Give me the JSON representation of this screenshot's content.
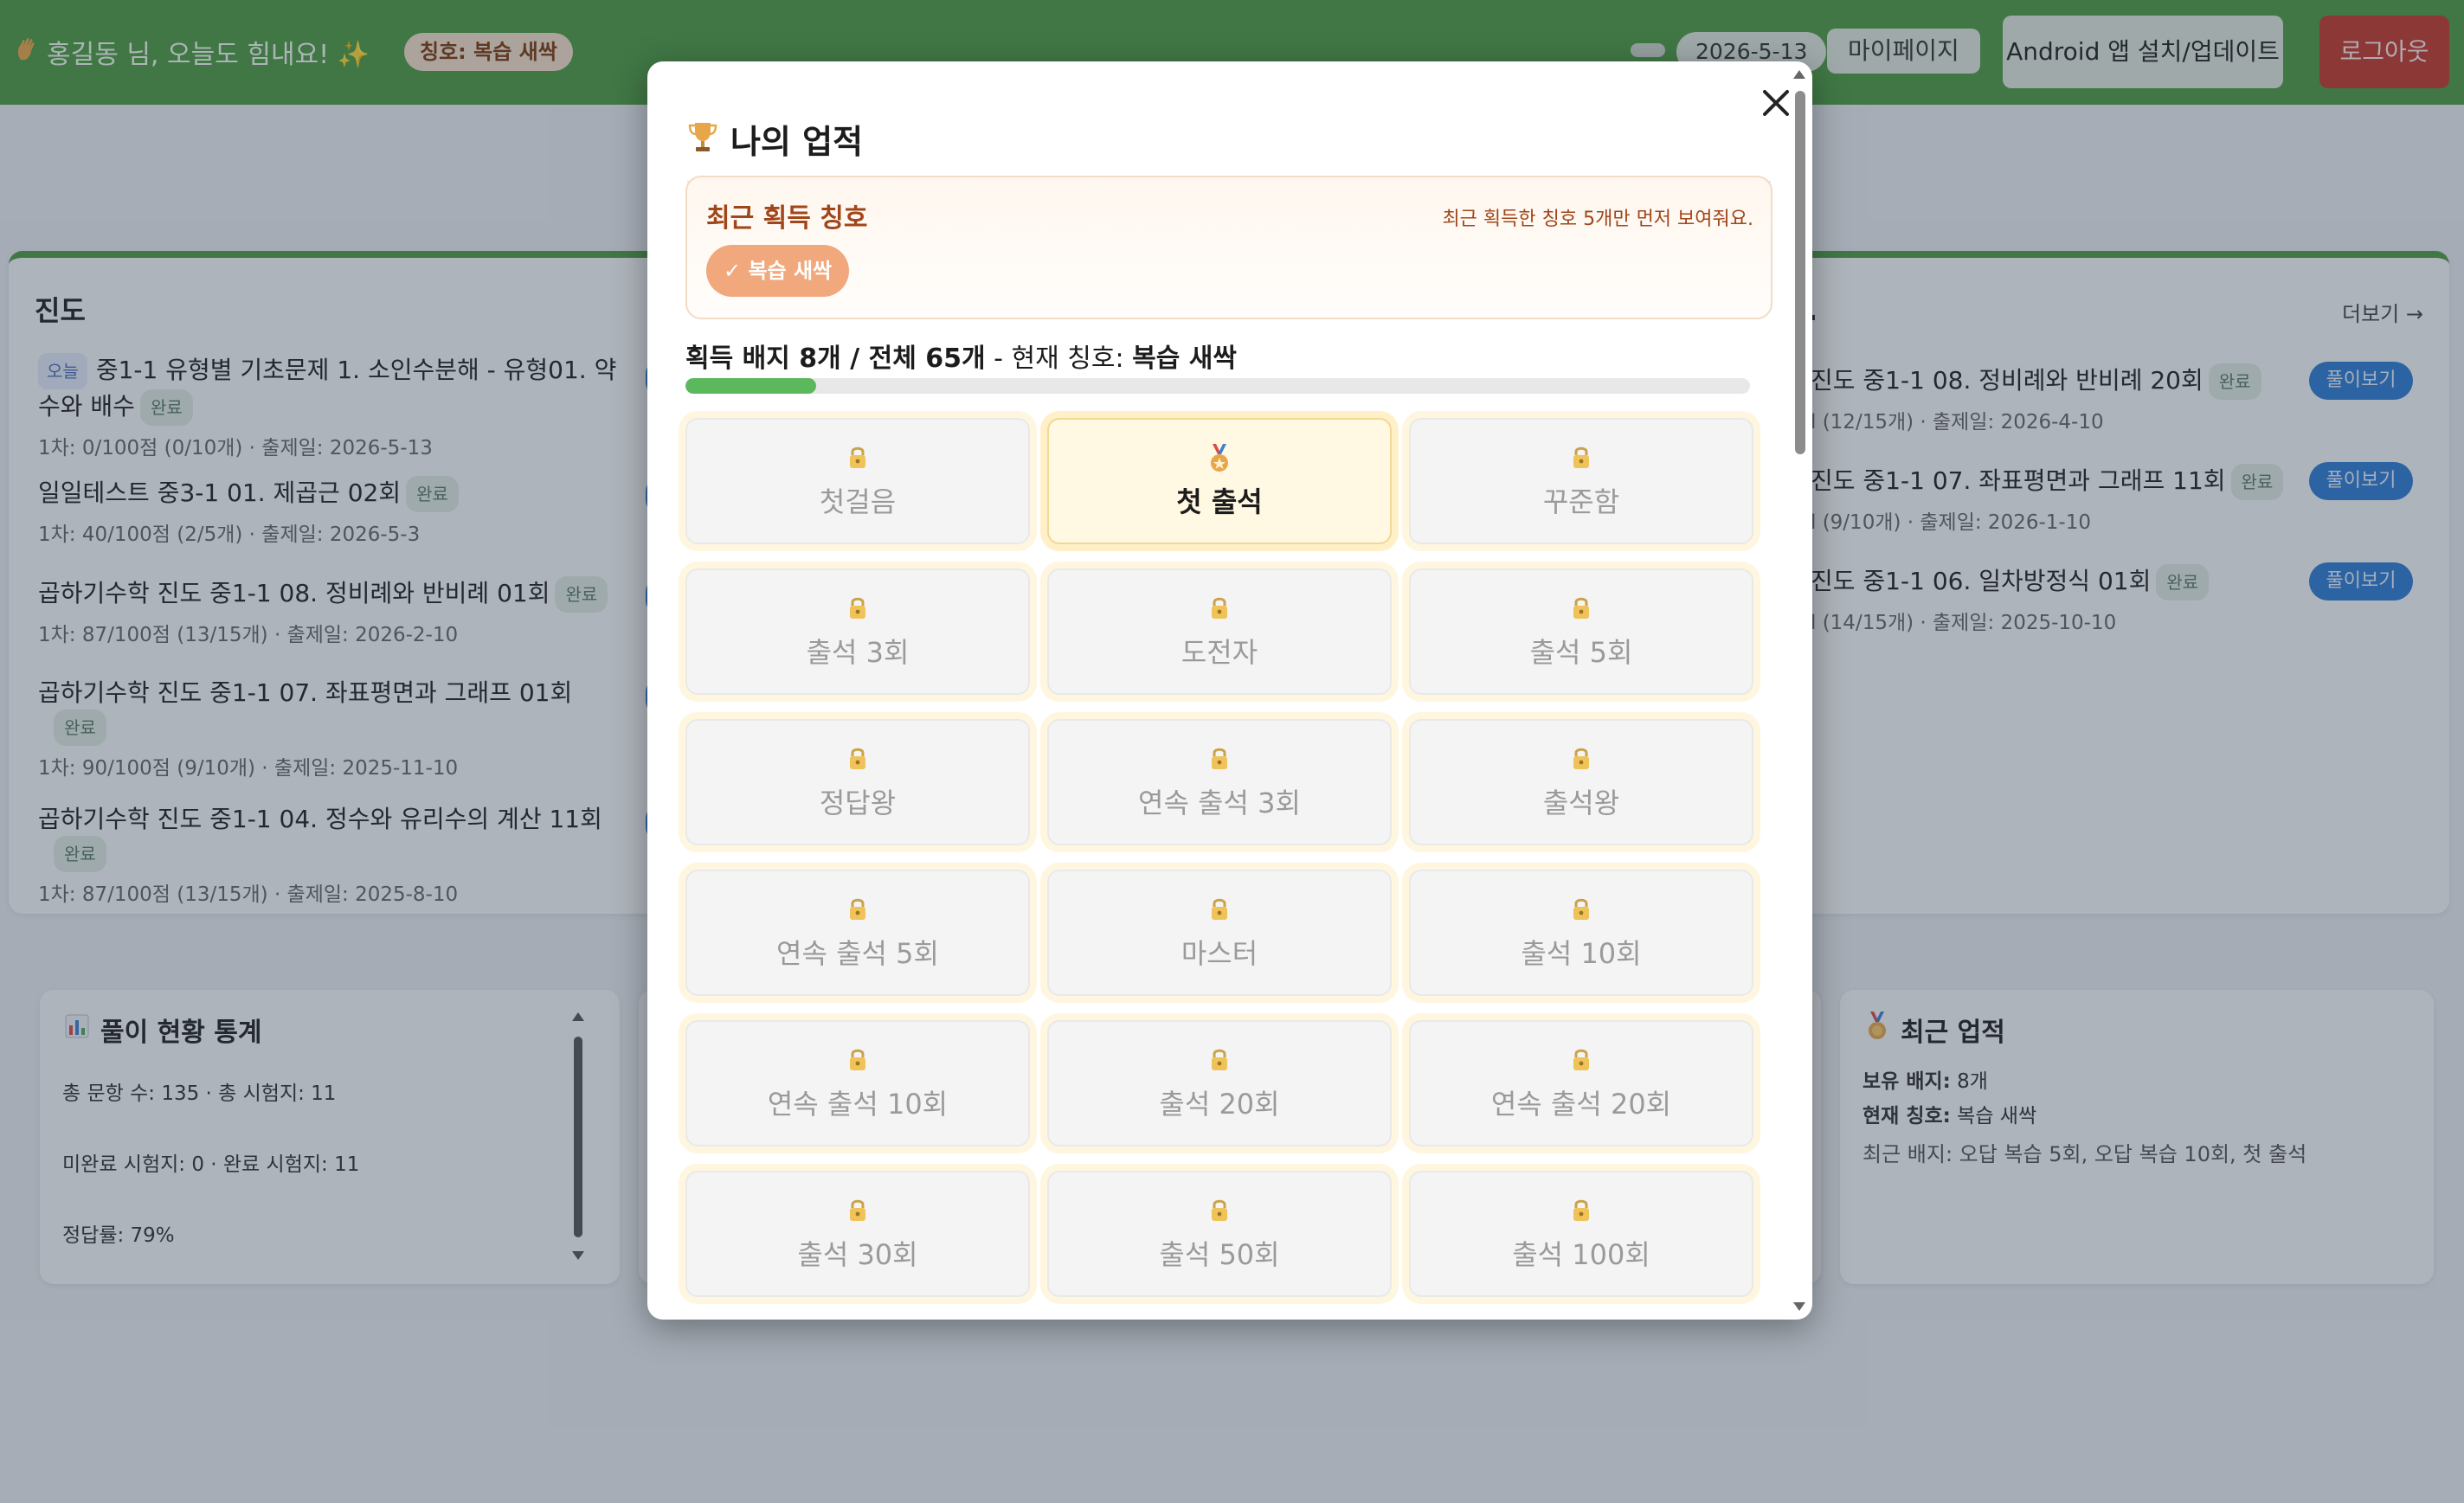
{
  "topbar": {
    "greeting": "홍길동 님, 오늘도 힘내요! ✨",
    "title_badge": "칭호: 복습 새싹",
    "date": "2026-5-13",
    "mypage": "마이페이지",
    "app_install": "Android 앱 설치/업데이트",
    "logout": "로그아웃"
  },
  "progress_left": {
    "heading": "진도",
    "items": [
      {
        "tag": "오늘",
        "title": "중1-1 유형별 기초문제 1. 소인수분해 - 유형01. 약수와 배수",
        "status": "완료",
        "meta": "1차: 0/100점 (0/10개) · 출제일: 2026-5-13"
      },
      {
        "title": "일일테스트 중3-1 01. 제곱근 02회",
        "status": "완료",
        "meta": "1차: 40/100점 (2/5개) · 출제일: 2026-5-3"
      },
      {
        "title": "곱하기수학 진도 중1-1 08. 정비례와 반비례 01회",
        "status": "완료",
        "meta": "1차: 87/100점 (13/15개) · 출제일: 2026-2-10"
      },
      {
        "title": "곱하기수학 진도 중1-1 07. 좌표평면과 그래프 01회",
        "status": "완료",
        "meta": "1차: 90/100점 (9/10개) · 출제일: 2025-11-10"
      },
      {
        "title": "곱하기수학 진도 중1-1 04. 정수와 유리수의 계산 11회",
        "status": "완료",
        "meta": "1차: 87/100점 (13/15개) · 출제일: 2025-8-10"
      }
    ]
  },
  "progress_right": {
    "heading_tail": ".",
    "more": "더보기 →",
    "solve": "풀이보기",
    "items": [
      {
        "title": "진도 중1-1 08. 정비례와 반비례 20회",
        "status": "완료",
        "meta": "l (12/15개) · 출제일: 2026-4-10"
      },
      {
        "title": "진도 중1-1 07. 좌표평면과 그래프 11회",
        "status": "완료",
        "meta": "l (9/10개) · 출제일: 2026-1-10"
      },
      {
        "title": "진도 중1-1 06. 일차방정식 01회",
        "status": "완료",
        "meta": "l (14/15개) · 출제일: 2025-10-10"
      }
    ]
  },
  "stats": {
    "heading": "풀이 현황 통계",
    "line1": "총 문항 수: 135 · 총 시험지: 11",
    "line2": "미완료 시험지: 0 · 완료 시험지: 11",
    "line3": "정답률: 79%"
  },
  "recent_achievements": {
    "heading": "최근 업적",
    "badges_label": "보유 배지:",
    "badges_value": "8개",
    "current_label": "현재 칭호:",
    "current_value": "복습 새싹",
    "recent": "최근 배지: 오답 복습 5회, 오답 복습 10회, 첫 출석"
  },
  "modal": {
    "title": "나의 업적",
    "recent_title": "최근 획득 칭호",
    "recent_note": "최근 획득한 칭호 5개만 먼저 보여줘요.",
    "selected_chip": "✓ 복습 새싹",
    "count_prefix": "획득 배지 8개 / 전체 65개",
    "count_mid": " - 현재 칭호: ",
    "count_title": "복습 새싹",
    "progress": 0.123,
    "badges": [
      {
        "name": "첫걸음",
        "earned": false
      },
      {
        "name": "첫 출석",
        "earned": true
      },
      {
        "name": "꾸준함",
        "earned": false
      },
      {
        "name": "출석 3회",
        "earned": false
      },
      {
        "name": "도전자",
        "earned": false
      },
      {
        "name": "출석 5회",
        "earned": false
      },
      {
        "name": "정답왕",
        "earned": false
      },
      {
        "name": "연속 출석 3회",
        "earned": false
      },
      {
        "name": "출석왕",
        "earned": false
      },
      {
        "name": "연속 출석 5회",
        "earned": false
      },
      {
        "name": "마스터",
        "earned": false
      },
      {
        "name": "출석 10회",
        "earned": false
      },
      {
        "name": "연속 출석 10회",
        "earned": false
      },
      {
        "name": "출석 20회",
        "earned": false
      },
      {
        "name": "연속 출석 20회",
        "earned": false
      },
      {
        "name": "출석 30회",
        "earned": false
      },
      {
        "name": "출석 50회",
        "earned": false
      },
      {
        "name": "출석 100회",
        "earned": false
      }
    ]
  },
  "colors": {
    "topbar": "#4e9a43",
    "accent_blue": "#2f7cd1",
    "logout": "#c0392b",
    "progress_fill": "#5cb85c",
    "chip": "#f0a87c"
  }
}
